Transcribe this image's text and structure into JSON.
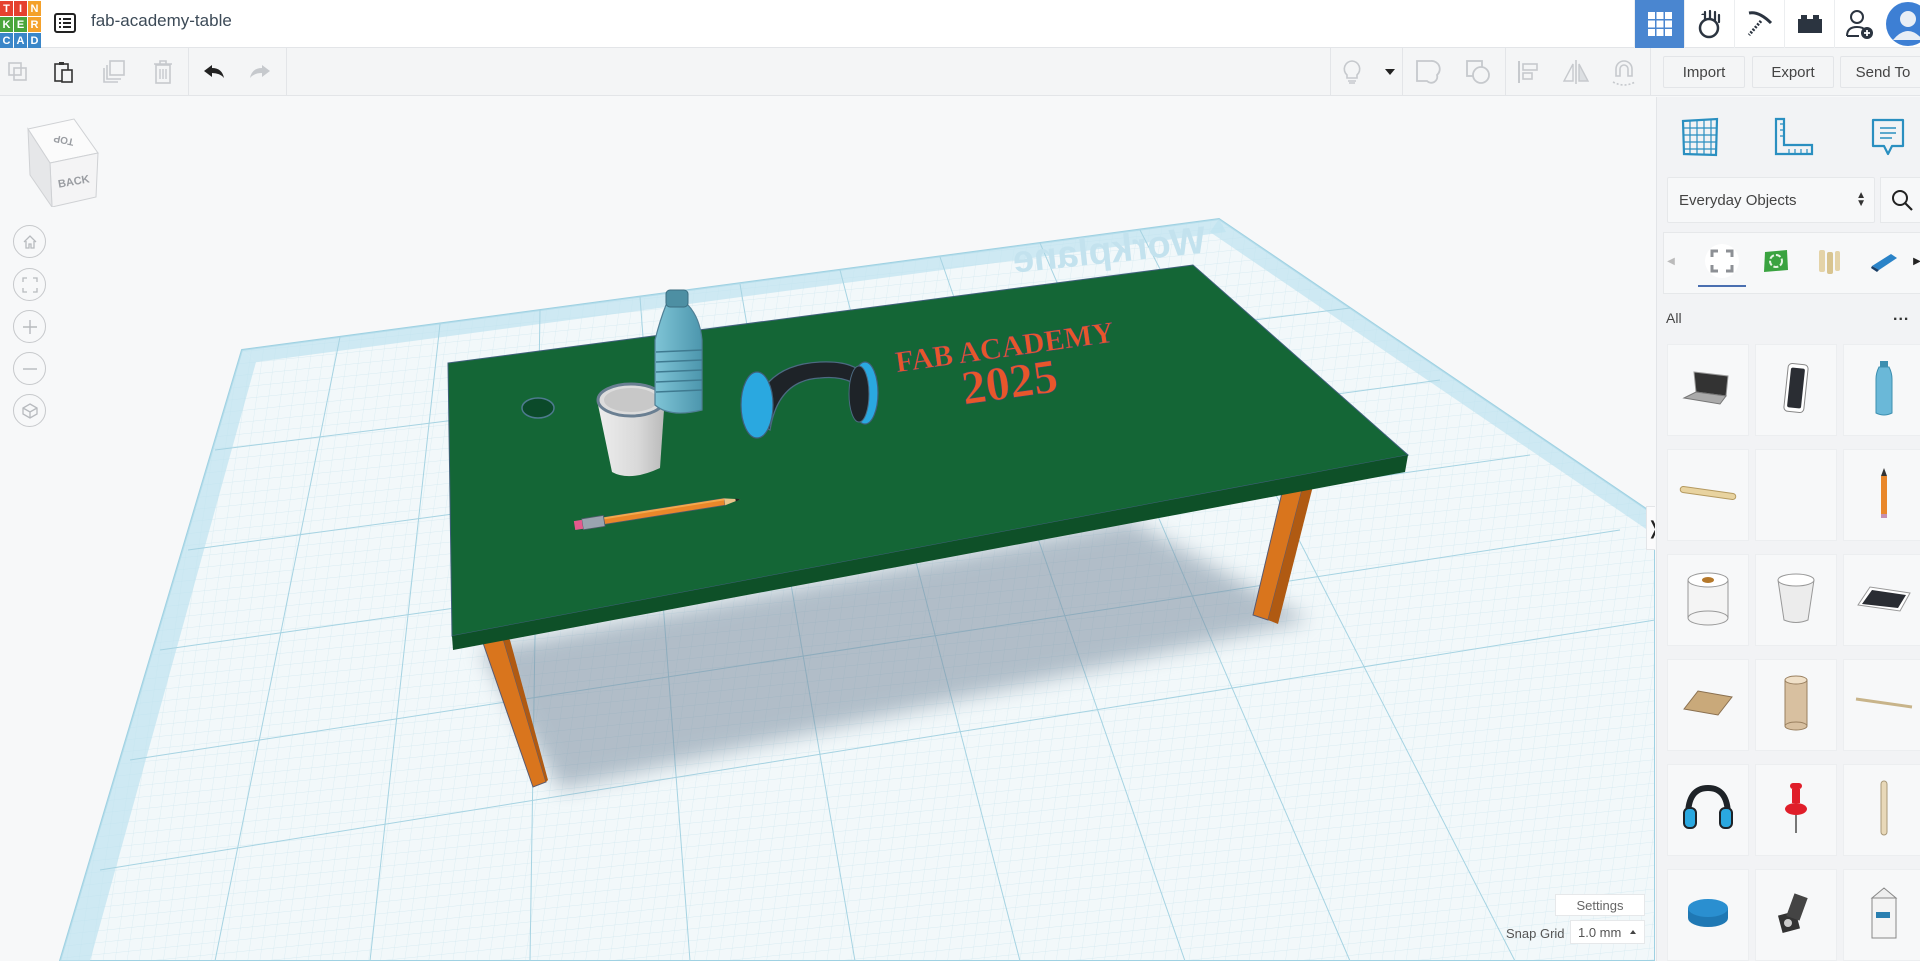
{
  "app": {
    "logo_letters": [
      "T",
      "I",
      "N",
      "K",
      "E",
      "R",
      "C",
      "A",
      "D"
    ],
    "logo_colors": [
      "#e5412e",
      "#e5412e",
      "#f4a12b",
      "#4aa53b",
      "#4aa53b",
      "#f4a12b",
      "#3a86c8",
      "#3a86c8",
      "#3a86c8"
    ],
    "design_title": "fab-academy-table"
  },
  "header_nav": [
    {
      "name": "3d-design",
      "icon": "grid-icon",
      "active": true
    },
    {
      "name": "circuits",
      "icon": "hand-apple-icon",
      "active": false
    },
    {
      "name": "minecraft",
      "icon": "pickaxe-icon",
      "active": false
    },
    {
      "name": "bricks",
      "icon": "brick-icon",
      "active": false
    },
    {
      "name": "invite",
      "icon": "add-user-icon",
      "active": false
    },
    {
      "name": "profile",
      "icon": "avatar-icon",
      "active": false
    }
  ],
  "toolbar": {
    "left_tools": [
      "copy",
      "paste",
      "duplicate",
      "delete",
      "undo",
      "redo"
    ],
    "right_tools": [
      "light-bulb",
      "dropdown",
      "group",
      "ungroup",
      "align",
      "mirror",
      "cruise"
    ],
    "import_label": "Import",
    "export_label": "Export",
    "send_to_label": "Send To"
  },
  "viewcube": {
    "top_label": "TOP",
    "front_label": "BACK"
  },
  "view_controls": [
    "home-view",
    "fit-all",
    "zoom-in",
    "zoom-out",
    "orthographic"
  ],
  "workplane": {
    "label": "Workplane"
  },
  "scene": {
    "table_text_line1": "FAB ACADEMY",
    "table_text_line2": "2025",
    "objects": [
      "table",
      "bottle",
      "cup",
      "headphones",
      "pencil",
      "hole"
    ],
    "colors": {
      "table_top": "#146636",
      "table_edge": "#0e5028",
      "legs": "#d9751d",
      "text": "#e8562b",
      "grid_line": "#b9dde8",
      "workplane_border": "#a8d8ea"
    }
  },
  "bottom_controls": {
    "settings_label": "Settings",
    "snap_grid_label": "Snap Grid",
    "snap_grid_value": "1.0 mm"
  },
  "panel": {
    "top_icons": [
      "workplane-icon",
      "ruler-icon",
      "notes-icon"
    ],
    "library_select": "Everyday Objects",
    "categories": [
      "all-shapes",
      "recycle",
      "dowels",
      "stapler"
    ],
    "filter_label": "All",
    "more_label": "...",
    "shapes": [
      "Laptop",
      "Phone",
      "Water Bottle",
      "Popsicle Stick",
      "Blank",
      "Pencil",
      "Toilet Paper",
      "Cup",
      "Tablet",
      "Cork Board",
      "Tube",
      "Skewer",
      "Headphones",
      "Push Pin",
      "Stick",
      "Puck",
      "Camcorder",
      "Milk Carton"
    ]
  }
}
